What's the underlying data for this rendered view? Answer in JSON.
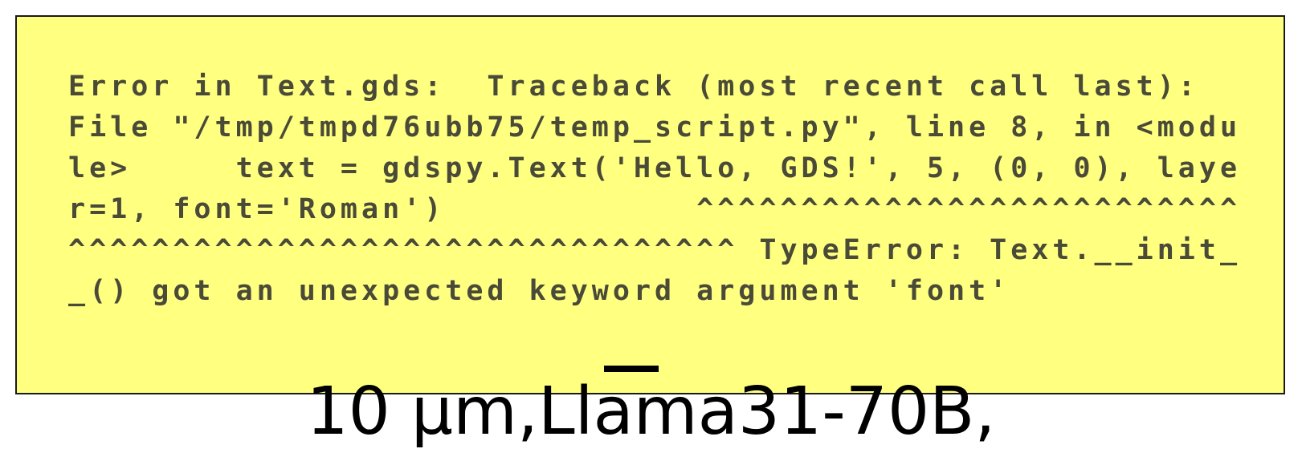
{
  "error_panel": {
    "message": "Error in Text.gds:  Traceback (most recent call last):   File \"/tmp/tmpd76ubb75/temp_script.py\", line 8, in <module>     text = gdspy.Text('Hello, GDS!', 5, (0, 0), layer=1, font='Roman')            ^^^^^^^^^^^^^^^^^^^^^^^^^^^^^^^^^^^^^^^^^^^^^^^^^^^^^^^^^^ TypeError: Text.__init__() got an unexpected keyword argument 'font'",
    "background_color": "#ffff80",
    "text_color": "#4a4a38"
  },
  "scale": {
    "label": "10 µm,Llama31-70B,"
  }
}
